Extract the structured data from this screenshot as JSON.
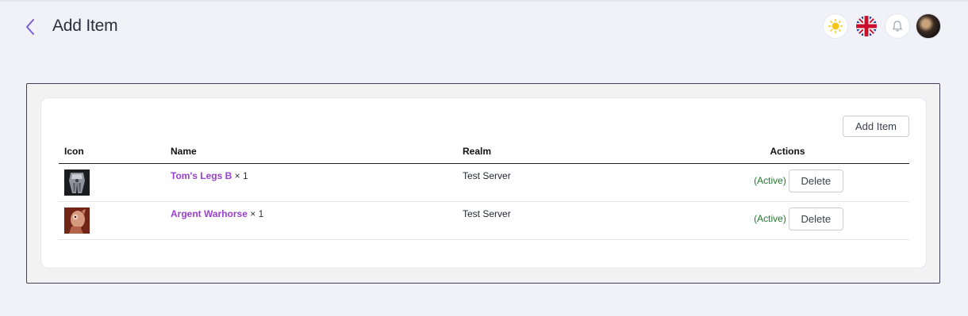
{
  "header": {
    "title": "Add Item",
    "icons": [
      "chevron-left-icon",
      "sun-icon",
      "uk-flag-icon",
      "bell-icon",
      "avatar"
    ]
  },
  "colors": {
    "accent": "#9a3fd0",
    "active": "#1e7b2a",
    "back_chevron": "#7b5bd6",
    "sun": "#f5c518"
  },
  "table": {
    "add_button_label": "Add Item",
    "columns": [
      "Icon",
      "Name",
      "Realm",
      "Actions"
    ],
    "rows": [
      {
        "icon": "armor-legs-icon",
        "name": "Tom's Legs B",
        "qty": "× 1",
        "realm": "Test Server",
        "status": "(Active)",
        "delete_label": "Delete"
      },
      {
        "icon": "warhorse-icon",
        "name": "Argent Warhorse",
        "qty": "× 1",
        "realm": "Test Server",
        "status": "(Active)",
        "delete_label": "Delete"
      }
    ]
  }
}
